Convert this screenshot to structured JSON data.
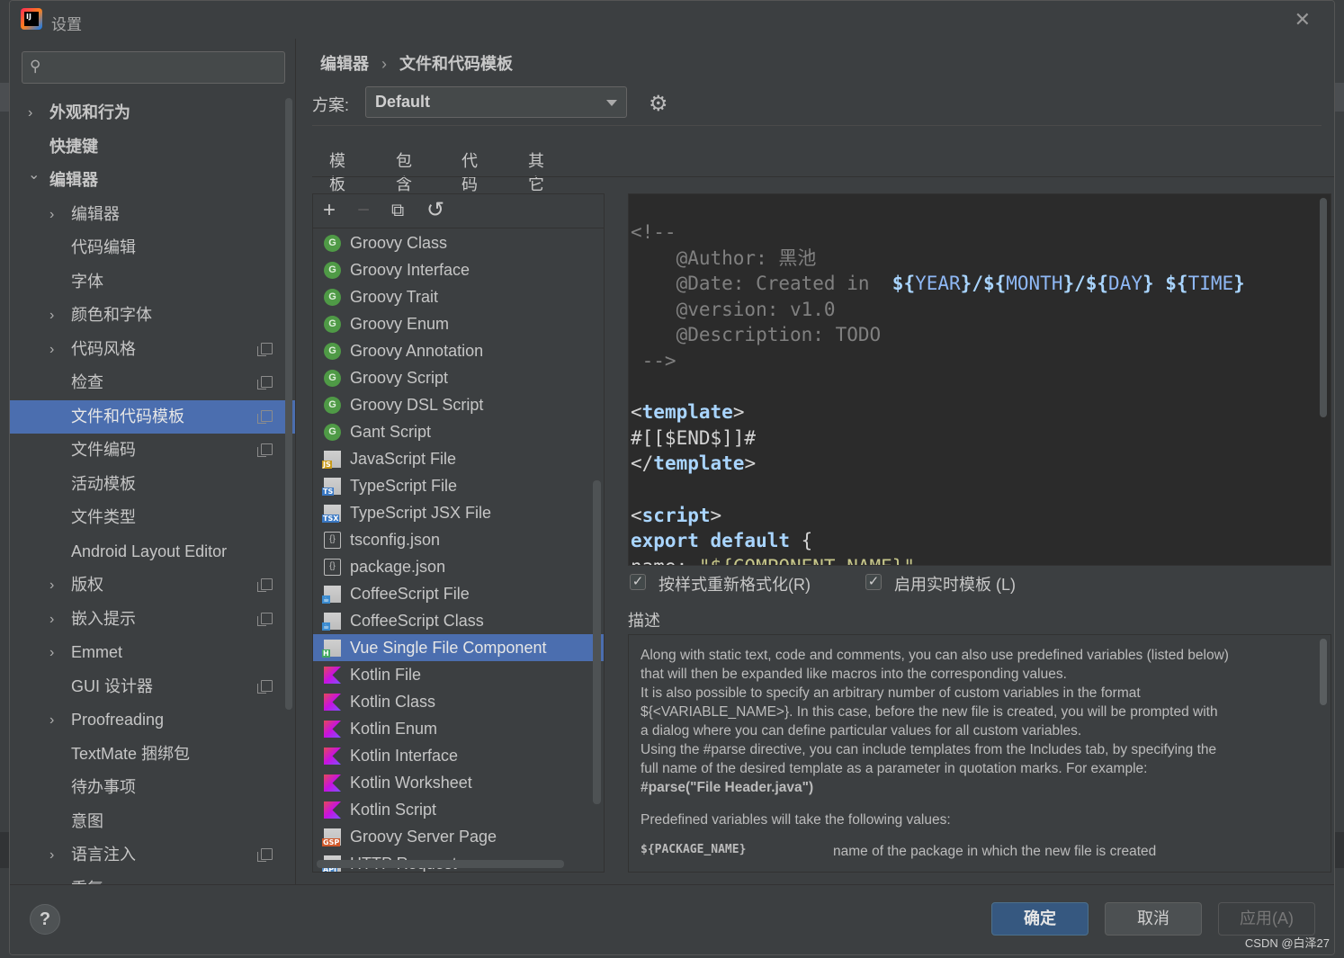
{
  "window": {
    "title": "设置",
    "app_icon_text": "IJ"
  },
  "search": {
    "placeholder": ""
  },
  "sidebar": {
    "items": [
      {
        "label": "外观和行为",
        "chevron": "›",
        "bold": true,
        "level": 0,
        "copy": false
      },
      {
        "label": "快捷键",
        "chevron": "",
        "bold": true,
        "level": 0,
        "copy": false
      },
      {
        "label": "编辑器",
        "chevron": "⌄",
        "bold": true,
        "level": 0,
        "copy": false
      },
      {
        "label": "编辑器",
        "chevron": "›",
        "bold": false,
        "level": 1,
        "copy": false
      },
      {
        "label": "代码编辑",
        "chevron": "",
        "bold": false,
        "level": 1,
        "copy": false
      },
      {
        "label": "字体",
        "chevron": "",
        "bold": false,
        "level": 1,
        "copy": false
      },
      {
        "label": "颜色和字体",
        "chevron": "›",
        "bold": false,
        "level": 1,
        "copy": false
      },
      {
        "label": "代码风格",
        "chevron": "›",
        "bold": false,
        "level": 1,
        "copy": true
      },
      {
        "label": "检查",
        "chevron": "",
        "bold": false,
        "level": 1,
        "copy": true
      },
      {
        "label": "文件和代码模板",
        "chevron": "",
        "bold": false,
        "level": 1,
        "copy": true,
        "selected": true
      },
      {
        "label": "文件编码",
        "chevron": "",
        "bold": false,
        "level": 1,
        "copy": true
      },
      {
        "label": "活动模板",
        "chevron": "",
        "bold": false,
        "level": 1,
        "copy": false
      },
      {
        "label": "文件类型",
        "chevron": "",
        "bold": false,
        "level": 1,
        "copy": false
      },
      {
        "label": "Android Layout Editor",
        "chevron": "",
        "bold": false,
        "level": 1,
        "copy": false
      },
      {
        "label": "版权",
        "chevron": "›",
        "bold": false,
        "level": 1,
        "copy": true
      },
      {
        "label": "嵌入提示",
        "chevron": "›",
        "bold": false,
        "level": 1,
        "copy": true
      },
      {
        "label": "Emmet",
        "chevron": "›",
        "bold": false,
        "level": 1,
        "copy": false
      },
      {
        "label": "GUI 设计器",
        "chevron": "",
        "bold": false,
        "level": 1,
        "copy": true
      },
      {
        "label": "Proofreading",
        "chevron": "›",
        "bold": false,
        "level": 1,
        "copy": false
      },
      {
        "label": "TextMate 捆绑包",
        "chevron": "",
        "bold": false,
        "level": 1,
        "copy": false
      },
      {
        "label": "待办事项",
        "chevron": "",
        "bold": false,
        "level": 1,
        "copy": false
      },
      {
        "label": "意图",
        "chevron": "",
        "bold": false,
        "level": 1,
        "copy": false
      },
      {
        "label": "语言注入",
        "chevron": "›",
        "bold": false,
        "level": 1,
        "copy": true
      },
      {
        "label": "重复",
        "chevron": "",
        "bold": false,
        "level": 1,
        "copy": false
      }
    ]
  },
  "breadcrumb": {
    "parent": "编辑器",
    "separator": "›",
    "current": "文件和代码模板"
  },
  "scheme": {
    "label": "方案:",
    "value": "Default"
  },
  "tabs": [
    {
      "label": "模板",
      "active": true
    },
    {
      "label": "包含",
      "active": false
    },
    {
      "label": "代码",
      "active": false
    },
    {
      "label": "其它",
      "active": false
    }
  ],
  "toolbar": {
    "add": "+",
    "remove": "−",
    "copy": "⧉",
    "reset": "↺"
  },
  "templates": [
    {
      "label": "Groovy Class",
      "icon": "groovy-icon"
    },
    {
      "label": "Groovy Interface",
      "icon": "groovy-icon"
    },
    {
      "label": "Groovy Trait",
      "icon": "groovy-icon"
    },
    {
      "label": "Groovy Enum",
      "icon": "groovy-icon"
    },
    {
      "label": "Groovy Annotation",
      "icon": "groovy-icon"
    },
    {
      "label": "Groovy Script",
      "icon": "groovy-icon"
    },
    {
      "label": "Groovy DSL Script",
      "icon": "groovy-icon"
    },
    {
      "label": "Gant Script",
      "icon": "groovy-icon"
    },
    {
      "label": "JavaScript File",
      "icon": "javascript-file-icon",
      "tag": "JS",
      "tag_color": "#c89a1a"
    },
    {
      "label": "TypeScript File",
      "icon": "typescript-file-icon",
      "tag": "TS",
      "tag_color": "#3a78c3"
    },
    {
      "label": "TypeScript JSX File",
      "icon": "tsx-file-icon",
      "tag": "TSX",
      "tag_color": "#3a78c3"
    },
    {
      "label": "tsconfig.json",
      "icon": "json-file-icon"
    },
    {
      "label": "package.json",
      "icon": "json-file-icon"
    },
    {
      "label": "CoffeeScript File",
      "icon": "coffeescript-file-icon",
      "tag": "☕",
      "tag_color": "#3a8bd0"
    },
    {
      "label": "CoffeeScript Class",
      "icon": "coffeescript-file-icon",
      "tag": "☕",
      "tag_color": "#3a8bd0"
    },
    {
      "label": "Vue Single File Component",
      "icon": "vue-file-icon",
      "tag": "H",
      "tag_color": "#41a85f",
      "selected": true
    },
    {
      "label": "Kotlin File",
      "icon": "kotlin-file-icon"
    },
    {
      "label": "Kotlin Class",
      "icon": "kotlin-file-icon"
    },
    {
      "label": "Kotlin Enum",
      "icon": "kotlin-file-icon"
    },
    {
      "label": "Kotlin Interface",
      "icon": "kotlin-file-icon"
    },
    {
      "label": "Kotlin Worksheet",
      "icon": "kotlin-file-icon"
    },
    {
      "label": "Kotlin Script",
      "icon": "kotlin-file-icon"
    },
    {
      "label": "Groovy Server Page",
      "icon": "gsp-file-icon",
      "tag": "GSP",
      "tag_color": "#d0582a"
    },
    {
      "label": "HTTP Request",
      "icon": "http-file-icon",
      "tag": "API",
      "tag_color": "#4a86c6"
    }
  ],
  "editor": {
    "lines": [
      [
        {
          "t": "<!--",
          "c": "c-com"
        }
      ],
      [
        {
          "t": "    @Author: 黑池",
          "c": "c-com"
        }
      ],
      [
        {
          "t": "    @Date: Created in  ",
          "c": "c-com"
        },
        {
          "t": "${",
          "c": "c-kw"
        },
        {
          "t": "YEAR",
          "c": "c-var"
        },
        {
          "t": "}/${",
          "c": "c-kw"
        },
        {
          "t": "MONTH",
          "c": "c-var"
        },
        {
          "t": "}/${",
          "c": "c-kw"
        },
        {
          "t": "DAY",
          "c": "c-var"
        },
        {
          "t": "} ${",
          "c": "c-kw"
        },
        {
          "t": "TIME",
          "c": "c-var"
        },
        {
          "t": "}",
          "c": "c-kw"
        }
      ],
      [
        {
          "t": "    @version: v1.0",
          "c": "c-com"
        }
      ],
      [
        {
          "t": "    @Description: TODO",
          "c": "c-com"
        }
      ],
      [
        {
          "t": " -->",
          "c": "c-com"
        }
      ],
      [
        {
          "t": "",
          "c": "c-plain"
        }
      ],
      [
        {
          "t": "<",
          "c": "c-plain"
        },
        {
          "t": "template",
          "c": "c-tagname"
        },
        {
          "t": ">",
          "c": "c-plain"
        }
      ],
      [
        {
          "t": "#[[$END$]]#",
          "c": "c-plain"
        }
      ],
      [
        {
          "t": "</",
          "c": "c-plain"
        },
        {
          "t": "template",
          "c": "c-tagname"
        },
        {
          "t": ">",
          "c": "c-plain"
        }
      ],
      [
        {
          "t": "",
          "c": "c-plain"
        }
      ],
      [
        {
          "t": "<",
          "c": "c-plain"
        },
        {
          "t": "script",
          "c": "c-tagname"
        },
        {
          "t": ">",
          "c": "c-plain"
        }
      ],
      [
        {
          "t": "export default ",
          "c": "c-kw"
        },
        {
          "t": "{",
          "c": "c-plain"
        }
      ],
      [
        {
          "t": "name: ",
          "c": "c-plain"
        },
        {
          "t": "\"${COMPONENT_NAME}\"",
          "c": "c-str"
        }
      ]
    ]
  },
  "options": {
    "reformat": {
      "label": "按样式重新格式化(R)",
      "checked": true
    },
    "live_templates": {
      "label": "启用实时模板 (L)",
      "checked": true
    }
  },
  "description": {
    "title": "描述",
    "lines": [
      "Along with static text, code and comments, you can also use predefined variables (listed below)",
      "that will then be expanded like macros into the corresponding values.",
      "It is also possible to specify an arbitrary number of custom variables in the format",
      "${<VARIABLE_NAME>}. In this case, before the new file is created, you will be prompted with",
      "a dialog where you can define particular values for all custom variables.",
      "Using the #parse directive, you can include templates from the Includes tab, by specifying the",
      "full name of the desired template as a parameter in quotation marks. For example:",
      "#parse(\"File Header.java\")",
      "Predefined variables will take the following values:"
    ],
    "var_name": "${PACKAGE_NAME}",
    "var_desc": "name of the package in which the new file is created"
  },
  "footer": {
    "help": "?",
    "ok": "确定",
    "cancel": "取消",
    "apply": "应用(A)"
  },
  "watermark": "CSDN @白泽27"
}
